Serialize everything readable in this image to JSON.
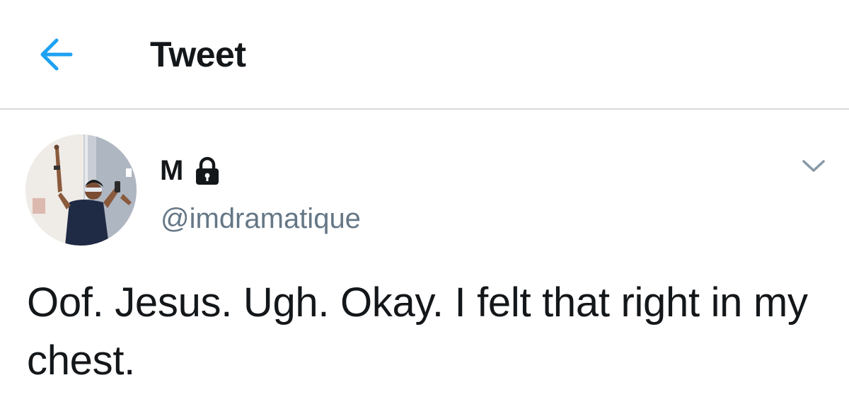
{
  "header": {
    "back_icon": "arrow-left-icon",
    "title": "Tweet"
  },
  "tweet": {
    "author": {
      "display_name": "M",
      "protected_icon": "lock-icon",
      "handle": "@imdramatique"
    },
    "menu_icon": "chevron-down-icon",
    "text": "Oof. Jesus. Ugh. Okay. I felt that right in my chest."
  },
  "colors": {
    "accent": "#1da1f2",
    "text_primary": "#14171a",
    "text_secondary": "#657786",
    "divider": "#d6d9db",
    "chevron": "#8899a6"
  }
}
